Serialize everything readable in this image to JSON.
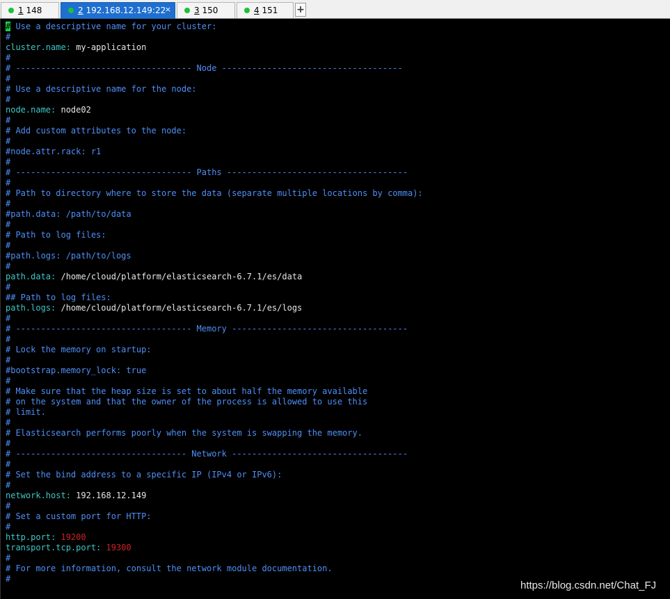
{
  "tabs": [
    {
      "num": "1",
      "label": "148",
      "active": false
    },
    {
      "num": "2",
      "label": "192.168.12.149:22",
      "active": true
    },
    {
      "num": "3",
      "label": "150",
      "active": false
    },
    {
      "num": "4",
      "label": "151",
      "active": false
    }
  ],
  "add_tab_label": "+",
  "close_glyph": "×",
  "terminal": {
    "colors": {
      "comment": "#4f8ff7",
      "key": "#3fc6c6",
      "value": "#e6e6e6",
      "number": "#d02020",
      "cursor": "#19d14a"
    },
    "lines": [
      {
        "t": "c",
        "cursor": "#",
        "text": " Use a descriptive name for your cluster:"
      },
      {
        "t": "c",
        "text": "#"
      },
      {
        "t": "kv",
        "key": "cluster.name",
        "value": "my-application"
      },
      {
        "t": "c",
        "text": "#"
      },
      {
        "t": "c",
        "text": "# ----------------------------------- Node ------------------------------------"
      },
      {
        "t": "c",
        "text": "#"
      },
      {
        "t": "c",
        "text": "# Use a descriptive name for the node:"
      },
      {
        "t": "c",
        "text": "#"
      },
      {
        "t": "kv",
        "key": "node.name",
        "value": "node02"
      },
      {
        "t": "c",
        "text": "#"
      },
      {
        "t": "c",
        "text": "# Add custom attributes to the node:"
      },
      {
        "t": "c",
        "text": "#"
      },
      {
        "t": "c",
        "text": "#node.attr.rack: r1"
      },
      {
        "t": "c",
        "text": "#"
      },
      {
        "t": "c",
        "text": "# ----------------------------------- Paths ------------------------------------"
      },
      {
        "t": "c",
        "text": "#"
      },
      {
        "t": "c",
        "text": "# Path to directory where to store the data (separate multiple locations by comma):"
      },
      {
        "t": "c",
        "text": "#"
      },
      {
        "t": "c",
        "text": "#path.data: /path/to/data"
      },
      {
        "t": "c",
        "text": "#"
      },
      {
        "t": "c",
        "text": "# Path to log files:"
      },
      {
        "t": "c",
        "text": "#"
      },
      {
        "t": "c",
        "text": "#path.logs: /path/to/logs"
      },
      {
        "t": "c",
        "text": "#"
      },
      {
        "t": "kv",
        "key": "path.data",
        "value": "/home/cloud/platform/elasticsearch-6.7.1/es/data"
      },
      {
        "t": "c",
        "text": "#"
      },
      {
        "t": "c",
        "text": "## Path to log files:"
      },
      {
        "t": "kv",
        "key": "path.logs",
        "value": "/home/cloud/platform/elasticsearch-6.7.1/es/logs"
      },
      {
        "t": "c",
        "text": "#"
      },
      {
        "t": "c",
        "text": "# ----------------------------------- Memory -----------------------------------"
      },
      {
        "t": "c",
        "text": "#"
      },
      {
        "t": "c",
        "text": "# Lock the memory on startup:"
      },
      {
        "t": "c",
        "text": "#"
      },
      {
        "t": "c",
        "text": "#bootstrap.memory_lock: true"
      },
      {
        "t": "c",
        "text": "#"
      },
      {
        "t": "c",
        "text": "# Make sure that the heap size is set to about half the memory available"
      },
      {
        "t": "c",
        "text": "# on the system and that the owner of the process is allowed to use this"
      },
      {
        "t": "c",
        "text": "# limit."
      },
      {
        "t": "c",
        "text": "#"
      },
      {
        "t": "c",
        "text": "# Elasticsearch performs poorly when the system is swapping the memory."
      },
      {
        "t": "c",
        "text": "#"
      },
      {
        "t": "c",
        "text": "# ---------------------------------- Network -----------------------------------"
      },
      {
        "t": "c",
        "text": "#"
      },
      {
        "t": "c",
        "text": "# Set the bind address to a specific IP (IPv4 or IPv6):"
      },
      {
        "t": "c",
        "text": "#"
      },
      {
        "t": "kv",
        "key": "network.host",
        "value": "192.168.12.149"
      },
      {
        "t": "c",
        "text": "#"
      },
      {
        "t": "c",
        "text": "# Set a custom port for HTTP:"
      },
      {
        "t": "c",
        "text": "#"
      },
      {
        "t": "kn",
        "key": "http.port",
        "value": "19200"
      },
      {
        "t": "kn",
        "key": "transport.tcp.port",
        "value": "19300"
      },
      {
        "t": "c",
        "text": "#"
      },
      {
        "t": "c",
        "text": "# For more information, consult the network module documentation."
      },
      {
        "t": "c",
        "text": "#"
      }
    ]
  },
  "watermark": "https://blog.csdn.net/Chat_FJ"
}
